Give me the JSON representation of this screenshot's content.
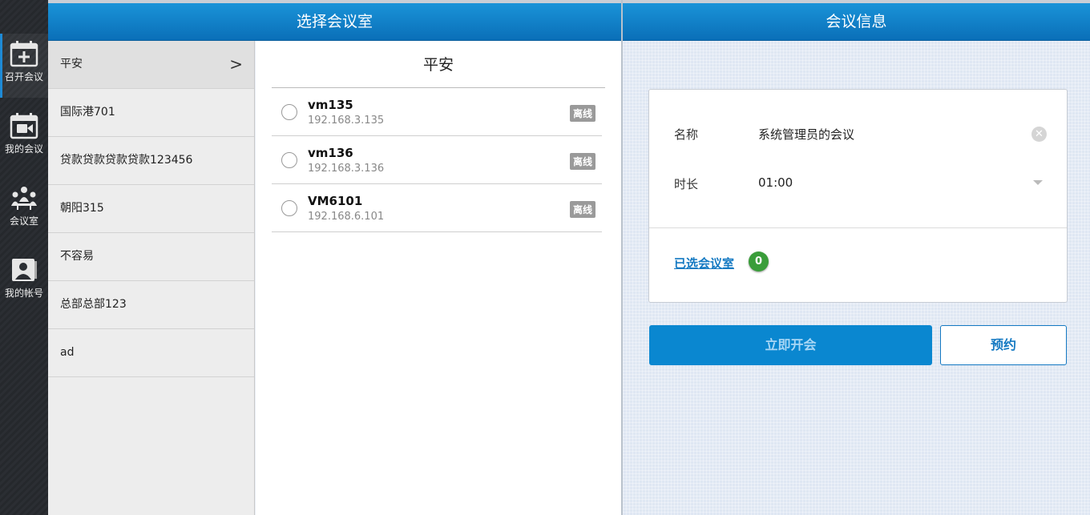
{
  "nav": {
    "items": [
      {
        "label": "召开会议",
        "icon": "calendar-plus-icon"
      },
      {
        "label": "我的会议",
        "icon": "calendar-video-icon"
      },
      {
        "label": "会议室",
        "icon": "meeting-room-icon"
      },
      {
        "label": "我的帐号",
        "icon": "user-account-icon"
      }
    ]
  },
  "header": {
    "left_title": "选择会议室",
    "right_title": "会议信息"
  },
  "groups": [
    {
      "label": "平安"
    },
    {
      "label": "国际港701"
    },
    {
      "label": "贷款贷款贷款贷款123456"
    },
    {
      "label": "朝阳315"
    },
    {
      "label": "不容易"
    },
    {
      "label": "总部总部123"
    },
    {
      "label": "ad"
    }
  ],
  "room_panel": {
    "title": "平安",
    "rooms": [
      {
        "name": "vm135",
        "ip": "192.168.3.135",
        "status": "离线"
      },
      {
        "name": "vm136",
        "ip": "192.168.3.136",
        "status": "离线"
      },
      {
        "name": "VM6101",
        "ip": "192.168.6.101",
        "status": "离线"
      }
    ]
  },
  "meeting_info": {
    "name_label": "名称",
    "name_value": "系统管理员的会议",
    "duration_label": "时长",
    "duration_value": "01:00",
    "selected_rooms_label": "已选会议室",
    "selected_count": "0",
    "start_button": "立即开会",
    "book_button": "预约"
  },
  "colors": {
    "header_blue": "#0a80c8",
    "accent": "#1479c2",
    "offline_badge": "#9a9a9a",
    "count_badge": "#3a9d3a"
  }
}
